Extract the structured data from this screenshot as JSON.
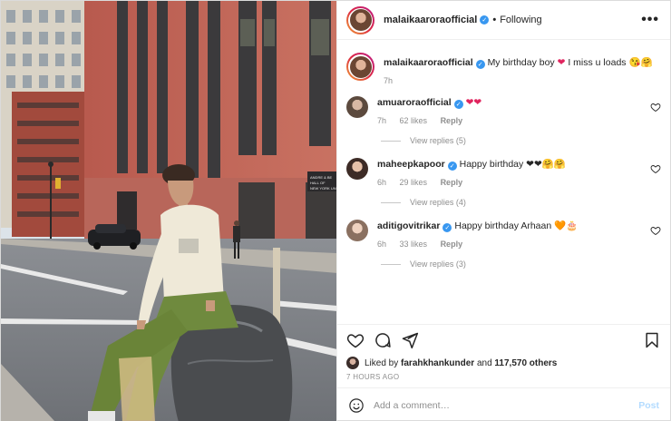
{
  "post": {
    "author": "malaikaaroraofficial",
    "separator": "•",
    "following_label": "Following",
    "more_label": "•••",
    "verified_mark": "✓"
  },
  "caption": {
    "username": "malaikaaroraofficial",
    "text": "My birthday boy ",
    "emoji_after_heart": " I miss u loads ",
    "emojis": "😘🤗",
    "heart": "❤",
    "time": "7h"
  },
  "comments": [
    {
      "username": "amuaroraofficial",
      "text": "",
      "emojis": "❤❤",
      "time": "7h",
      "likes": "62 likes",
      "reply_label": "Reply",
      "view_replies": "View replies (5)"
    },
    {
      "username": "maheepkapoor",
      "text": "Happy birthday ",
      "emojis": "❤❤🤗🤗",
      "time": "6h",
      "likes": "29 likes",
      "reply_label": "Reply",
      "view_replies": "View replies (4)"
    },
    {
      "username": "aditigovitrikar",
      "text": "Happy birthday Arhaan ",
      "emojis": "🧡🎂",
      "time": "6h",
      "likes": "33 likes",
      "reply_label": "Reply",
      "view_replies": "View replies (3)"
    }
  ],
  "engagement": {
    "liked_by_prefix": "Liked by ",
    "liked_by_user": "farahkhankunder",
    "and_label": " and ",
    "others": "117,570 others",
    "time_ago": "7 HOURS AGO"
  },
  "add_comment": {
    "placeholder": "Add a comment…",
    "post_label": "Post"
  },
  "photo": {
    "sign_text": "ANDRE & BE\nHALL OF\nNEW YORK UNI"
  },
  "icons": {
    "like": "heart-icon",
    "comment": "comment-icon",
    "share": "paper-plane-icon",
    "save": "bookmark-icon",
    "emoji": "smiley-icon",
    "more": "more-options-icon"
  },
  "colors": {
    "verified": "#3897f0",
    "heart": "#e0245e",
    "post_disabled": "#b3dbff",
    "muted": "#8e8e8e"
  }
}
